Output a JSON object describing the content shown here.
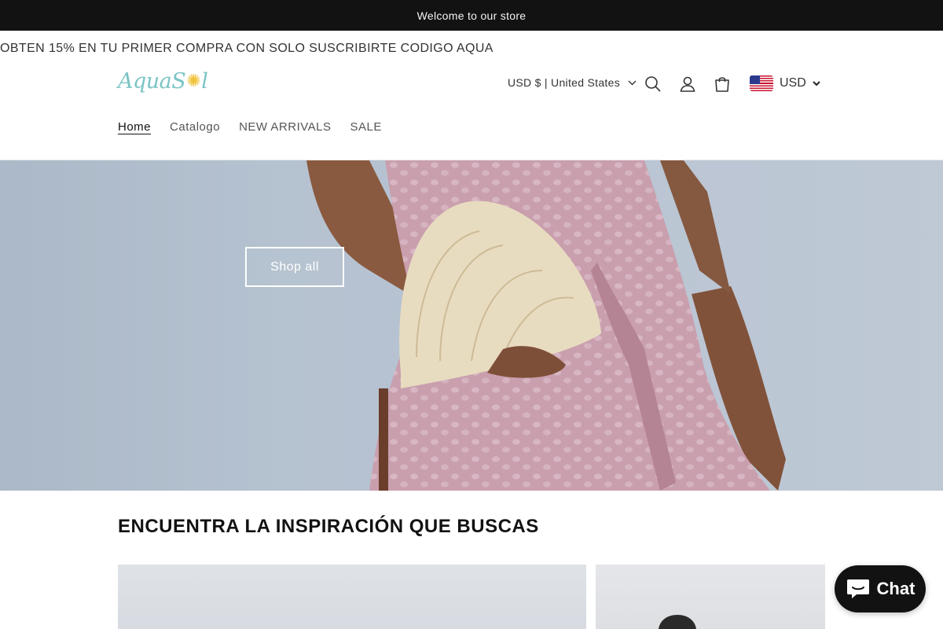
{
  "announcement": "Welcome to our store",
  "promo": "OBTEN 15% EN TU PRIMER COMPRA CON SOLO SUSCRIBIRTE CODIGO AQUA",
  "logo": {
    "part1": "Aqua",
    "part2": "S",
    "part3": "l"
  },
  "header": {
    "country_selector": "USD $ | United States",
    "icons": [
      "search-icon",
      "account-icon",
      "cart-icon"
    ],
    "currency": "USD"
  },
  "nav": [
    {
      "label": "Home",
      "active": true
    },
    {
      "label": "Catalogo",
      "active": false
    },
    {
      "label": "NEW ARRIVALS",
      "active": false
    },
    {
      "label": "SALE",
      "active": false
    }
  ],
  "hero": {
    "button_label": "Shop all"
  },
  "section": {
    "title": "ENCUENTRA LA INSPIRACIÓN QUE BUSCAS"
  },
  "chat": {
    "label": "Chat"
  },
  "colors": {
    "announcement_bg": "#121212",
    "logo": "#7cc4c5",
    "logo_accent": "#f0c33c",
    "chat_bg": "#121212"
  }
}
